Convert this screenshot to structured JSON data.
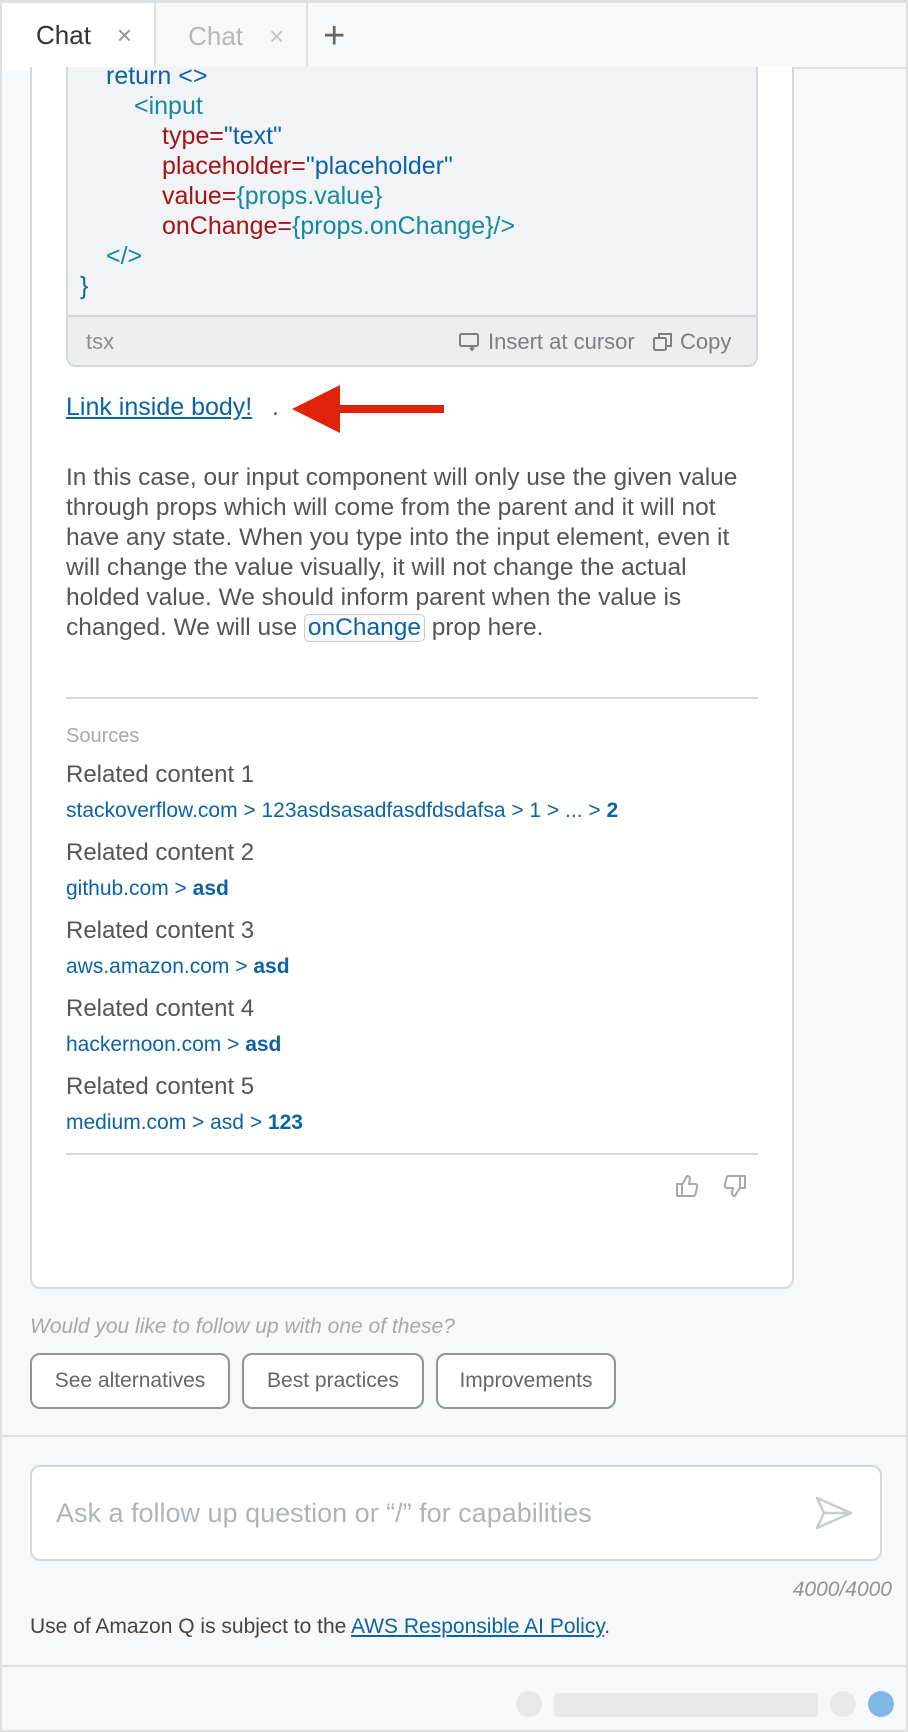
{
  "tabs": [
    {
      "label": "Chat",
      "close": "×",
      "active": true
    },
    {
      "label": "Chat",
      "close": "×",
      "active": false
    }
  ],
  "tab_add": "+",
  "code": {
    "lines": [
      [
        "return <>"
      ],
      [
        "<input"
      ],
      [
        "type=",
        "\"text\""
      ],
      [
        "placeholder=",
        "\"placeholder\""
      ],
      [
        "value=",
        "{props.value}"
      ],
      [
        "onChange=",
        "{props.onChange}/>"
      ],
      [
        "</>"
      ],
      [
        "}"
      ]
    ],
    "language": "tsx",
    "insert_label": "Insert at cursor",
    "copy_label": "Copy"
  },
  "body_link": {
    "text": "Link inside body!",
    "suffix": "."
  },
  "paragraph": {
    "before": "In this case, our input component will only use the given value through props which will come from the parent and it will not have any state. When you type into the input element, even it will change the value visually, it will not change the actual holded value. We should inform parent when the value is changed. We will use ",
    "code": "onChange",
    "after": " prop here."
  },
  "sources": {
    "title": "Sources",
    "items": [
      {
        "title": "Related content 1",
        "path": "stackoverflow.com > 123asdsasadfasdfdsdafsa > 1 > ... > ",
        "last": "2"
      },
      {
        "title": "Related content 2",
        "path": "github.com > ",
        "last": "asd"
      },
      {
        "title": "Related content 3",
        "path": "aws.amazon.com > ",
        "last": "asd"
      },
      {
        "title": "Related content 4",
        "path": "hackernoon.com > ",
        "last": "asd"
      },
      {
        "title": "Related content 5",
        "path": "medium.com > asd > ",
        "last": "123"
      }
    ]
  },
  "followup": {
    "question": "Would you like to follow up with one of these?",
    "chips": [
      "See alternatives",
      "Best practices",
      "Improvements"
    ]
  },
  "input": {
    "placeholder": "Ask a follow up question or “/” for capabilities",
    "counter": "4000/4000"
  },
  "policy": {
    "prefix": "Use of Amazon Q is subject to the ",
    "link": "AWS Responsible AI Policy",
    "suffix": "."
  },
  "colors": {
    "link": "#0b63a6",
    "arrow": "#e0240b",
    "status_dot": "#7fb6e6"
  }
}
